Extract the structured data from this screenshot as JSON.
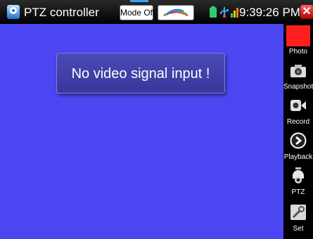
{
  "topbar": {
    "app_title": "PTZ controller",
    "mode_button_label": "Mode Off",
    "time": "9:39:26 PM",
    "close_symbol": "✕"
  },
  "icons": {
    "app": "ptz-camera-icon",
    "colorbar": "color-bar-test-icon",
    "battery": "battery-icon",
    "usb": "usb-icon",
    "network": "network-icon",
    "close": "close-icon"
  },
  "video": {
    "message": "No video signal input  !",
    "background_color": "#4b46f2"
  },
  "sidebar": {
    "items": [
      {
        "label": "Photo",
        "icon": "photo-icon"
      },
      {
        "label": "Snapshot",
        "icon": "snapshot-camera-icon"
      },
      {
        "label": "Record",
        "icon": "record-video-icon"
      },
      {
        "label": "Playback",
        "icon": "playback-icon"
      },
      {
        "label": "PTZ",
        "icon": "ptz-icon"
      },
      {
        "label": "Set",
        "icon": "settings-icon"
      }
    ]
  },
  "colors": {
    "accent_red": "#ff1f1f",
    "message_box": "#3f3ea8"
  }
}
